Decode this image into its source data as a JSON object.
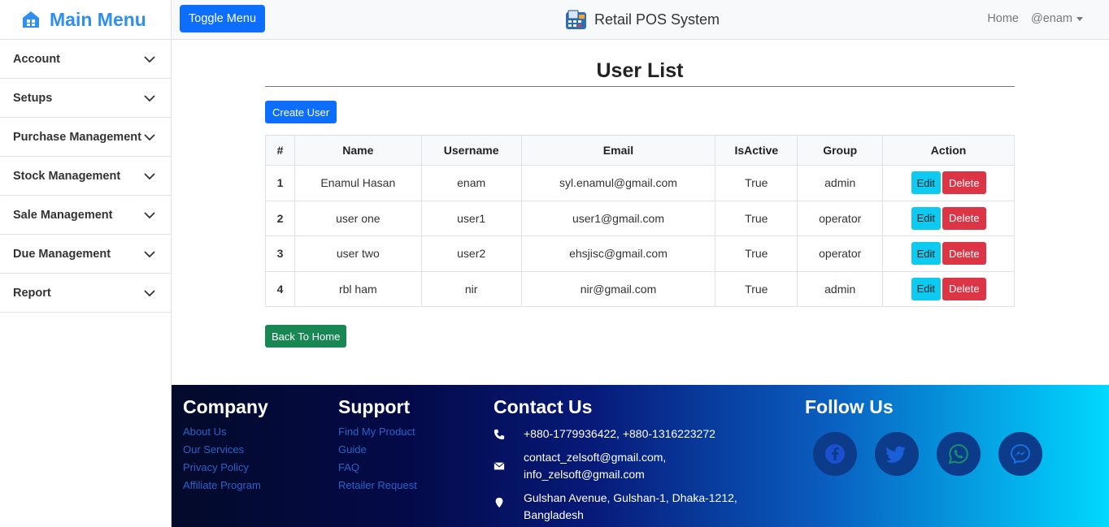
{
  "sidebar": {
    "title": "Main Menu",
    "items": [
      {
        "label": "Account"
      },
      {
        "label": "Setups"
      },
      {
        "label": "Purchase Management"
      },
      {
        "label": "Stock Management"
      },
      {
        "label": "Sale Management"
      },
      {
        "label": "Due Management"
      },
      {
        "label": "Report"
      }
    ]
  },
  "topbar": {
    "toggle_label": "Toggle Menu",
    "brand": "Retail POS System",
    "home_label": "Home",
    "user_label": "@enam"
  },
  "main": {
    "title": "User List",
    "create_label": "Create User",
    "back_label": "Back To Home",
    "columns": [
      "#",
      "Name",
      "Username",
      "Email",
      "IsActive",
      "Group",
      "Action"
    ],
    "rows": [
      {
        "idx": "1",
        "name": "Enamul Hasan",
        "username": "enam",
        "email": "syl.enamul@gmail.com",
        "active": "True",
        "group": "admin"
      },
      {
        "idx": "2",
        "name": "user one",
        "username": "user1",
        "email": "user1@gmail.com",
        "active": "True",
        "group": "operator"
      },
      {
        "idx": "3",
        "name": "user two",
        "username": "user2",
        "email": "ehsjisc@gmail.com",
        "active": "True",
        "group": "operator"
      },
      {
        "idx": "4",
        "name": "rbl ham",
        "username": "nir",
        "email": "nir@gmail.com",
        "active": "True",
        "group": "admin"
      }
    ],
    "edit_label": "Edit",
    "delete_label": "Delete"
  },
  "footer": {
    "company": {
      "title": "Company",
      "links": [
        "About Us",
        "Our Services",
        "Privacy Policy",
        "Affiliate Program"
      ]
    },
    "support": {
      "title": "Support",
      "links": [
        "Find My Product",
        "Guide",
        "FAQ",
        "Retailer Request"
      ]
    },
    "contact": {
      "title": "Contact Us",
      "phone": "+880-1779936422, +880-1316223272",
      "email_line1": "contact_zelsoft@gmail.com,",
      "email_line2": "info_zelsoft@gmail.com",
      "address_line1": "Gulshan Avenue, Gulshan-1, Dhaka-1212,",
      "address_line2": "Bangladesh"
    },
    "follow": {
      "title": "Follow Us",
      "icons": [
        "facebook-icon",
        "twitter-icon",
        "whatsapp-icon",
        "messenger-icon"
      ]
    }
  },
  "colors": {
    "primary": "#0d6efd",
    "info": "#0dcaf0",
    "danger": "#dc3545",
    "success": "#198754",
    "sidebar_title": "#2f8ff0"
  }
}
